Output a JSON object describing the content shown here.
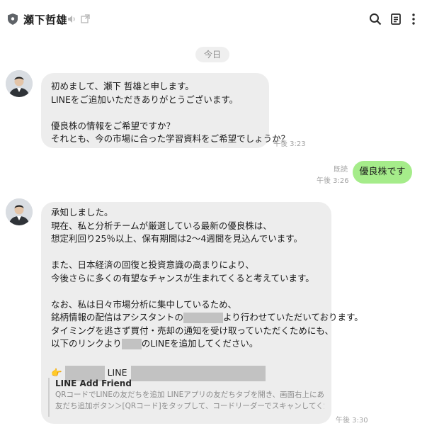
{
  "header": {
    "name": "瀬下哲雄",
    "icons": [
      "shield-icon",
      "mute-icon",
      "external-window-icon",
      "search-icon",
      "notes-icon",
      "more-icon"
    ]
  },
  "date_chip": "今日",
  "messages": [
    {
      "side": "in",
      "lines": [
        "初めまして、瀬下 哲雄と申します。",
        "LINEをご追加いただきありがとうございます。",
        "",
        "優良株の情報をご希望ですか？",
        "それとも、今の市場に合った学習資料をご希望でしょうか？"
      ],
      "time": "午後 3:23"
    },
    {
      "side": "out",
      "text": "優良株です",
      "read": "既読",
      "time": "午後 3:26"
    },
    {
      "side": "in",
      "lines": [
        "承知しました。",
        "現在、私と分析チームが厳選している最新の優良株は、",
        "想定利回り25％以上、保有期間は2〜4週間を見込んでいます。",
        "",
        "また、日本経済の回復と投資意識の高まりにより、",
        "今後さらに多くの有望なチャンスが生まれてくると考えています。",
        "",
        "なお、私は日々市場分析に集中しているため、"
      ],
      "line_redact_1_before": "銘柄情報の配信はアシスタントの",
      "line_redact_1_after": "より行わせていただいております。",
      "line_timing": "タイミングを逃さず買付・売却の通知を受け取っていただくためにも、",
      "line_redact_2_before": "以下のリンクより",
      "line_redact_2_after": "のLINEを追加してください。",
      "link_line_emoji": "👉",
      "link_line_label": "LINE",
      "link_card": {
        "title": "LINE Add Friend",
        "desc_1": "QRコードでLINEの友だちを追加 LINEアプリの友だちタブを開き、画面右上にある",
        "desc_2": "友だち追加ボタン＞[QRコード]をタップして、コードリーダーでスキャンしてください。..."
      },
      "time": "午後 3:30"
    }
  ],
  "colors": {
    "incoming_bubble": "#ededed",
    "outgoing_bubble": "#a5ec8a",
    "redaction": "#c2c2c2"
  }
}
